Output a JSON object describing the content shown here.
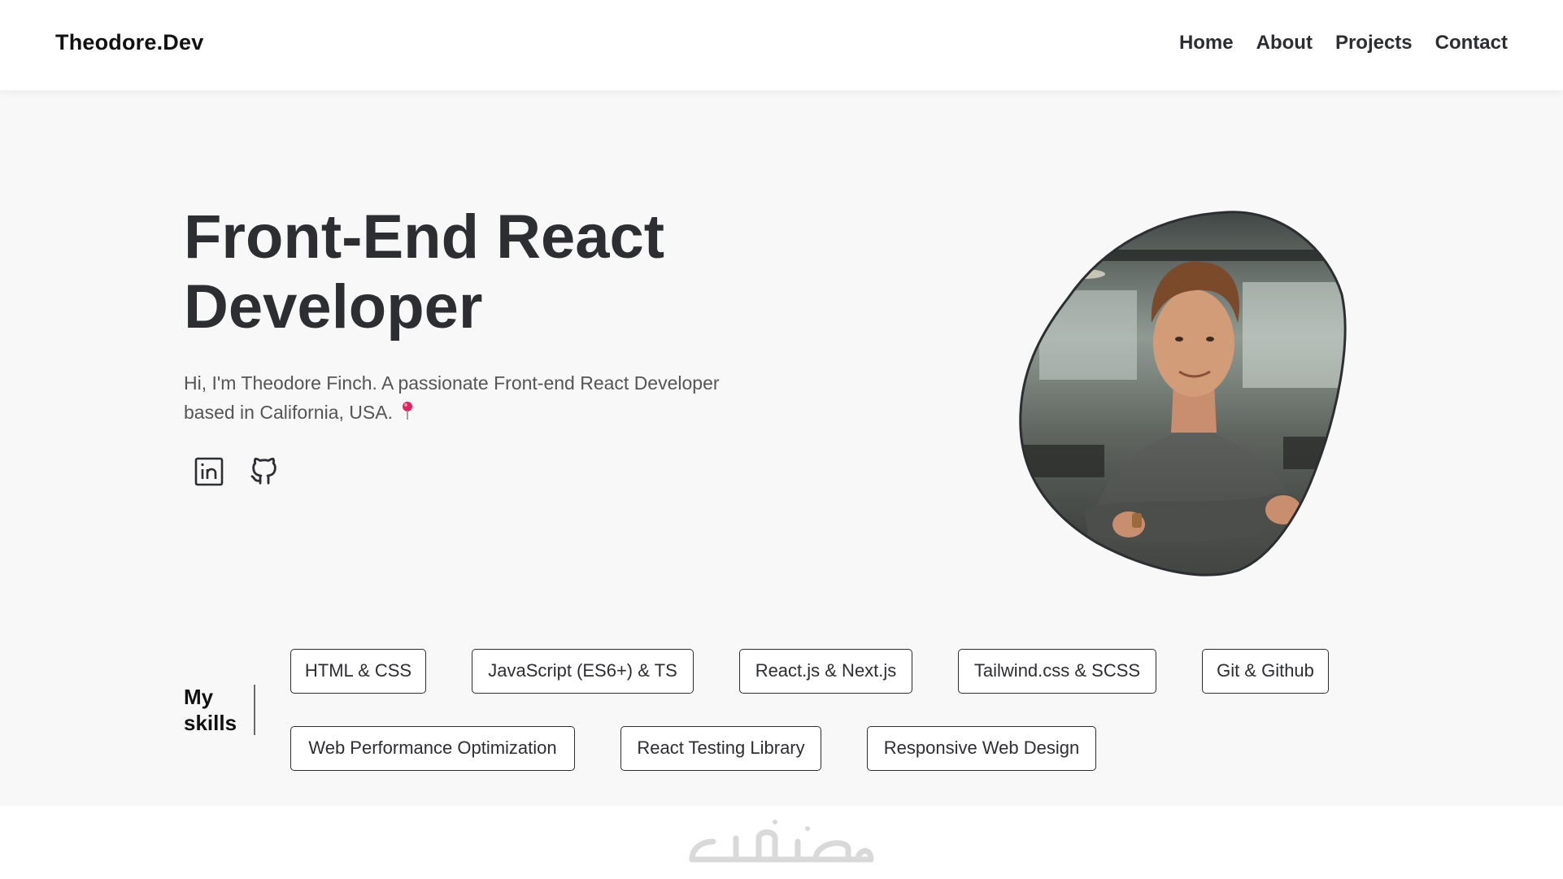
{
  "header": {
    "brand": "Theodore.Dev",
    "nav": [
      "Home",
      "About",
      "Projects",
      "Contact"
    ]
  },
  "hero": {
    "title_line1": "Front-End React",
    "title_line2": "Developer",
    "description": "Hi, I'm Theodore Finch. A passionate Front-end React Developer based in California, USA.",
    "location_icon": "pin-icon",
    "socials": [
      {
        "name": "linkedin-icon"
      },
      {
        "name": "github-icon"
      }
    ],
    "profile_image": "profile-photo"
  },
  "skills": {
    "label_line1": "My",
    "label_line2": "skills",
    "items": [
      "HTML & CSS",
      "JavaScript (ES6+) & TS",
      "React.js & Next.js",
      "Tailwind.css & SCSS",
      "Git & Github",
      "Web Performance Optimization",
      "React Testing Library",
      "Responsive Web Design"
    ]
  },
  "footer": {
    "watermark": "خمسات"
  },
  "colors": {
    "text_dark": "#2d2e32",
    "hero_bg": "#f8f8f8",
    "pin": "#e0245e"
  }
}
